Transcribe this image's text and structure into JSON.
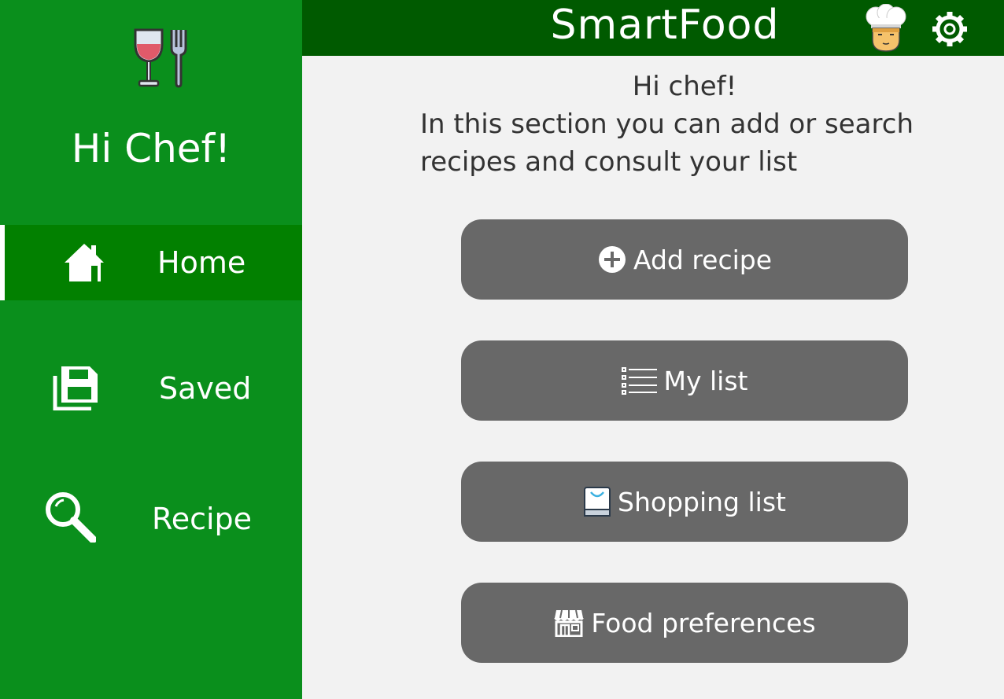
{
  "app": {
    "title": "SmartFood"
  },
  "sidebar": {
    "greeting": "Hi Chef!",
    "items": [
      {
        "label": "Home",
        "icon": "home-icon",
        "active": true
      },
      {
        "label": "Saved",
        "icon": "save-icon",
        "active": false
      },
      {
        "label": "Recipe",
        "icon": "search-icon",
        "active": false
      }
    ]
  },
  "main": {
    "welcome_line1": "Hi chef!",
    "welcome_line2": "In this section you can add or search",
    "welcome_line3": "recipes and consult your list",
    "buttons": [
      {
        "label": "Add recipe",
        "icon": "add-circle-icon"
      },
      {
        "label": "My list",
        "icon": "list-icon"
      },
      {
        "label": "Shopping list",
        "icon": "shopping-bag-icon"
      },
      {
        "label": "Food preferences",
        "icon": "store-icon"
      }
    ]
  },
  "colors": {
    "sidebar": "#0a8f1c",
    "sidebar_active": "#028000",
    "header": "#005a00",
    "button": "#686868",
    "background": "#f2f2f2"
  }
}
